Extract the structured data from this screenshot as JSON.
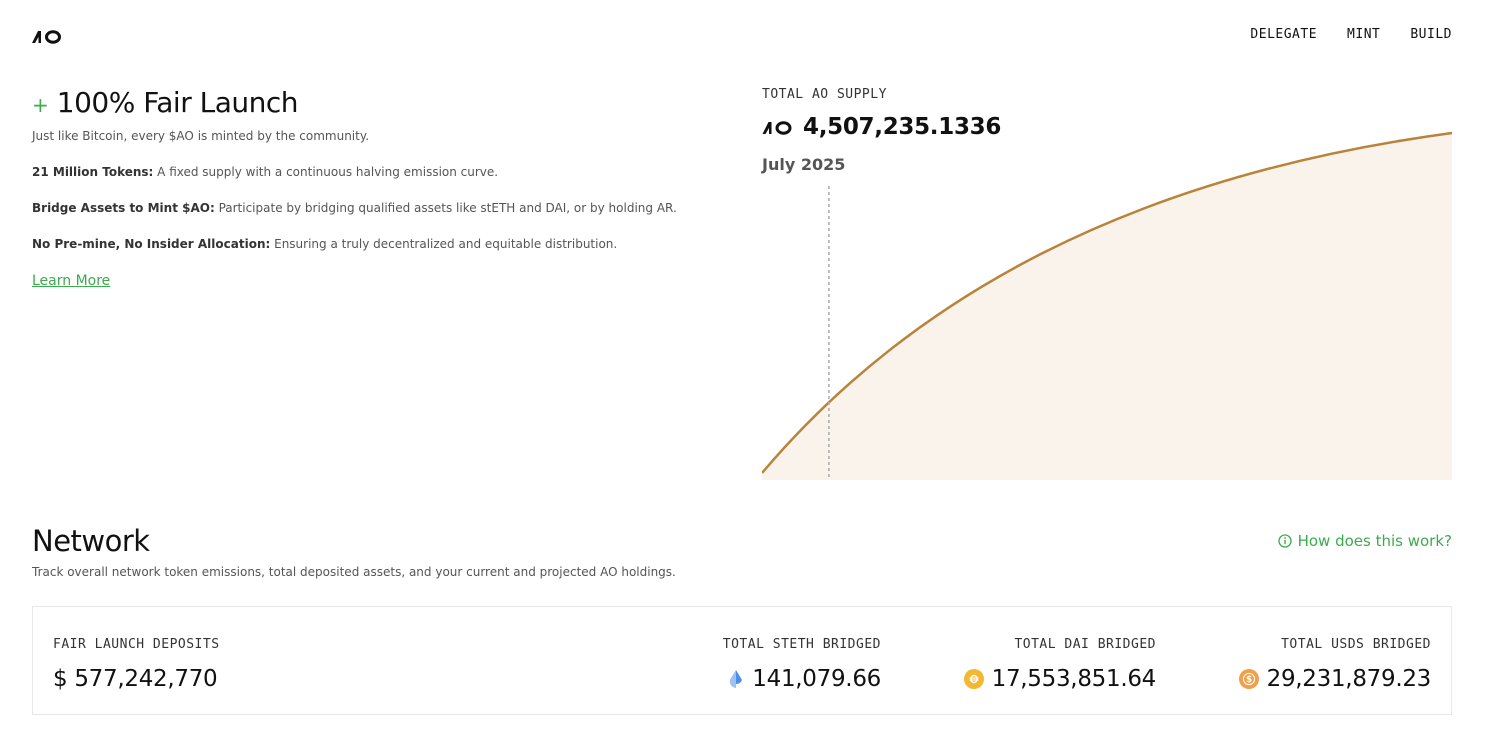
{
  "header": {
    "logo": "AO",
    "nav": [
      "DELEGATE",
      "MINT",
      "BUILD"
    ]
  },
  "hero": {
    "plus": "+",
    "title": "100% Fair Launch",
    "intro": "Just like Bitcoin, every $AO is minted by the community.",
    "features": [
      {
        "bold": "21 Million Tokens:",
        "text": " A fixed supply with a continuous halving emission curve."
      },
      {
        "bold": "Bridge Assets to Mint $AO:",
        "text": " Participate by bridging qualified assets like stETH and DAI, or by holding AR."
      },
      {
        "bold": "No Pre-mine, No Insider Allocation:",
        "text": " Ensuring a truly decentralized and equitable distribution."
      }
    ],
    "learn_more": "Learn More"
  },
  "supply": {
    "label": "TOTAL AO SUPPLY",
    "value": "4,507,235.1336",
    "date": "July 2025",
    "marker_fraction": 0.097
  },
  "network": {
    "title": "Network",
    "subtitle": "Track overall network token emissions, total deposited assets, and your current and projected AO holdings.",
    "how_link": "How does this work?"
  },
  "stats": [
    {
      "label": "FAIR LAUNCH DEPOSITS",
      "value": "$ 577,242,770",
      "icon": ""
    },
    {
      "label": "TOTAL STETH BRIDGED",
      "value": "141,079.66",
      "icon": "steth-drop-icon"
    },
    {
      "label": "TOTAL DAI BRIDGED",
      "value": "17,553,851.64",
      "icon": "dai-coin-icon"
    },
    {
      "label": "TOTAL USDS BRIDGED",
      "value": "29,231,879.23",
      "icon": "usds-coin-icon"
    }
  ],
  "colors": {
    "accent_green": "#3daa4e",
    "curve": "#b98339",
    "curve_fill": "#f9f3ec",
    "dai": "#f4b731",
    "usds": "#f0a04a",
    "steth": "#4e8ee8"
  }
}
